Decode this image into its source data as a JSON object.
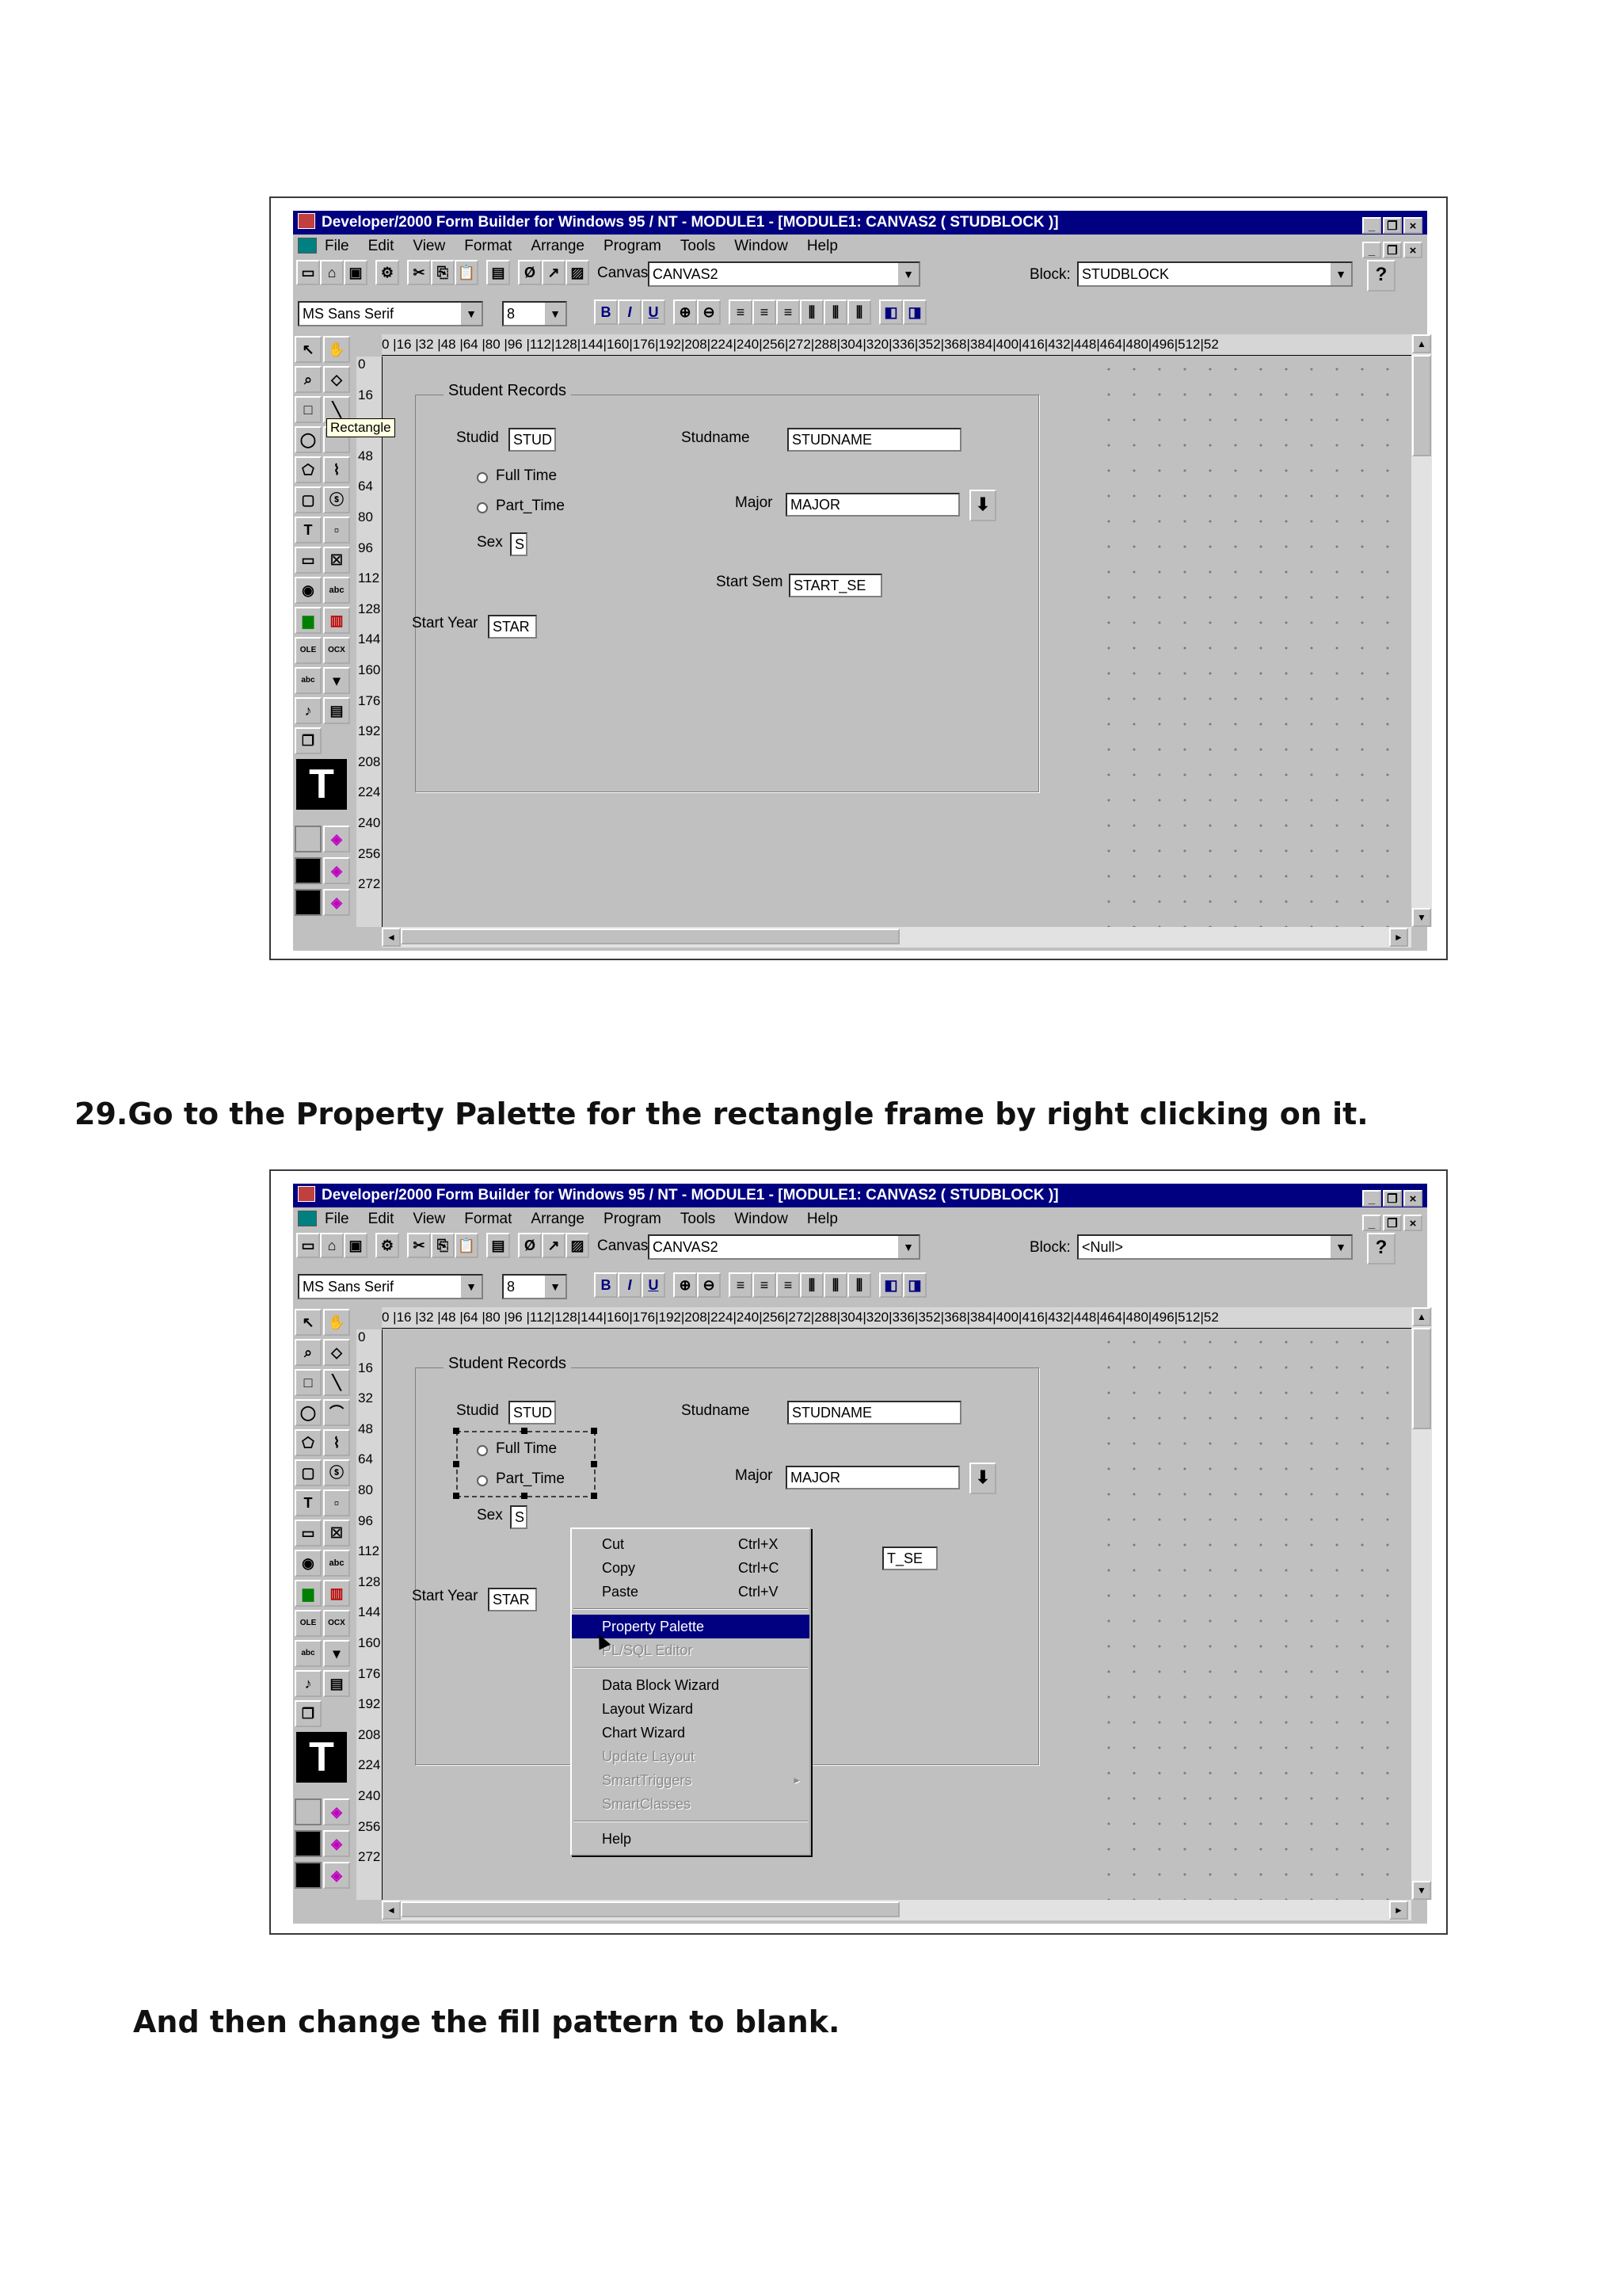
{
  "window": {
    "title": "Developer/2000 Form Builder for Windows 95 / NT - MODULE1 - [MODULE1: CANVAS2 ( STUDBLOCK )]",
    "menu": [
      "File",
      "Edit",
      "View",
      "Format",
      "Arrange",
      "Program",
      "Tools",
      "Window",
      "Help"
    ],
    "canvas_label": "Canvas:",
    "canvas_value": "CANVAS2",
    "block_label": "Block:",
    "font_name": "MS Sans Serif",
    "font_size": "8",
    "help_button": "?",
    "ruler_h": "0 |16 |32 |48 |64 |80 |96 |112|128|144|160|176|192|208|224|240|256|272|288|304|320|336|352|368|384|400|416|432|448|464|480|496|512|52",
    "ruler_v": [
      "0",
      "16",
      "32",
      "48",
      "64",
      "80",
      "96",
      "112",
      "128",
      "144",
      "160",
      "176",
      "192",
      "208",
      "224",
      "240",
      "256",
      "272"
    ]
  },
  "form": {
    "frame_title": "Student Records",
    "studid_label": "Studid",
    "studid_value": "STUD",
    "studname_label": "Studname",
    "studname_value": "STUDNAME",
    "radio_full": "Full Time",
    "radio_part": "Part_Time",
    "major_label": "Major",
    "major_value": "MAJOR",
    "sex_label": "Sex",
    "sex_value": "S",
    "start_sem_label": "Start Sem",
    "start_sem_value": "START_SE",
    "start_year_label": "Start Year",
    "start_year_value": "STAR"
  },
  "screenshot1": {
    "block_value": "STUDBLOCK",
    "tooltip": "Rectangle"
  },
  "screenshot2": {
    "block_value": "<Null>",
    "start_sem_partial": "T_SE",
    "context_menu": [
      {
        "label": "Cut",
        "shortcut": "Ctrl+X"
      },
      {
        "label": "Copy",
        "shortcut": "Ctrl+C"
      },
      {
        "label": "Paste",
        "shortcut": "Ctrl+V"
      },
      {
        "label": "Property Palette"
      },
      {
        "label": "PL/SQL Editor"
      },
      {
        "label": "Data Block Wizard"
      },
      {
        "label": "Layout Wizard"
      },
      {
        "label": "Chart Wizard"
      },
      {
        "label": "Update Layout"
      },
      {
        "label": "SmartTriggers"
      },
      {
        "label": "SmartClasses"
      },
      {
        "label": "Help"
      }
    ]
  },
  "captions": {
    "step29": "29.Go to the Property Palette for the rectangle frame by right clicking on it.",
    "fill": "And then change the fill pattern to blank."
  }
}
